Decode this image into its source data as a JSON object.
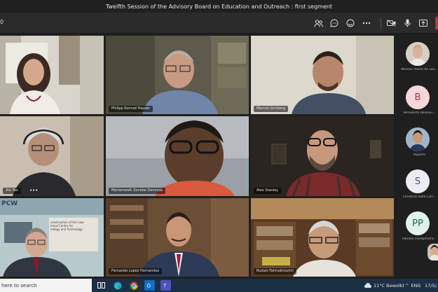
{
  "window": {
    "title": "Twelfth Session of the Advisory Board on Education and Outreach : first segment"
  },
  "toolbar": {
    "timer": "0",
    "icons": [
      "people-icon",
      "chat-icon",
      "reactions-icon",
      "more-icon",
      "camera-icon",
      "mic-icon",
      "share-icon"
    ]
  },
  "participants": [
    {
      "id": "p1",
      "name": ""
    },
    {
      "id": "p2",
      "name": "Philipp Konrad Hauser"
    },
    {
      "id": "p3",
      "name": "Marcos Grinberg"
    },
    {
      "id": "p4",
      "name": "Xin Tan"
    },
    {
      "id": "p5",
      "name": "Mariamawit Zenebe Demisse"
    },
    {
      "id": "p6",
      "name": "Alex Stanley"
    },
    {
      "id": "p7",
      "name": ""
    },
    {
      "id": "p8",
      "name": "Fernando Lopez Hernandez"
    },
    {
      "id": "p9",
      "name": "Ruslan Fahrudinovich"
    }
  ],
  "background_text": {
    "opcw_logo": "PCW",
    "banner": "construction of the new\nmical Centre for\nnology and Technology"
  },
  "rail": [
    {
      "initials": "",
      "name": "Moreno Ponce de Leo...",
      "color": "#d9d0c7"
    },
    {
      "initials": "B",
      "name": "Benedicta Reneau...",
      "color": "#f7d7db"
    },
    {
      "initials": "",
      "name": "Miyoshi",
      "color": "#8a6a55"
    },
    {
      "initials": "S",
      "name": "Christina Rolfe Carr...",
      "color": "#ececf5"
    },
    {
      "initials": "PP",
      "name": "Pandey Pushpendra...",
      "color": "#dff3ea"
    }
  ],
  "taskbar": {
    "search_placeholder": "here to search",
    "weather": "11°C  Bewolkt",
    "language": "ENG",
    "date": "17/5/..."
  }
}
